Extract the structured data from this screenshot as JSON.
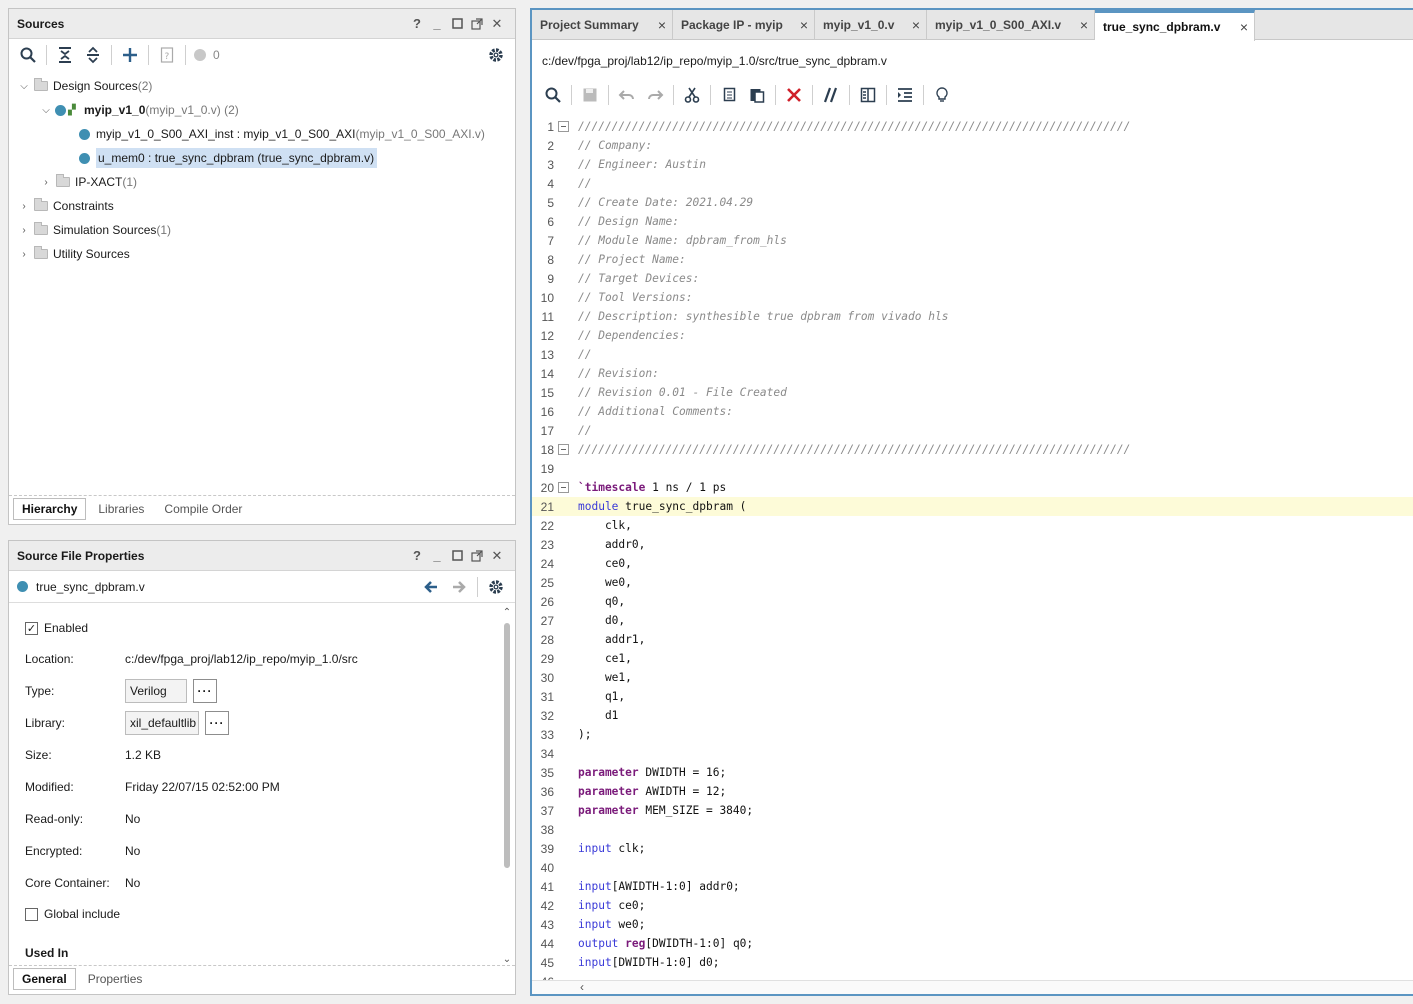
{
  "sources": {
    "title": "Sources",
    "badge_count": "0",
    "tree": [
      {
        "id": "design",
        "label": "Design Sources",
        "suffix": " (2)"
      },
      {
        "id": "myip",
        "label": "myip_v1_0",
        "suffix": " (myip_v1_0.v) (2)"
      },
      {
        "id": "axi",
        "label": "myip_v1_0_S00_AXI_inst : myip_v1_0_S00_AXI",
        "suffix": " (myip_v1_0_S00_AXI.v)"
      },
      {
        "id": "mem",
        "label": "u_mem0 : true_sync_dpbram (true_sync_dpbram.v)",
        "suffix": ""
      },
      {
        "id": "ipxact",
        "label": "IP-XACT",
        "suffix": " (1)"
      },
      {
        "id": "constraints",
        "label": "Constraints",
        "suffix": ""
      },
      {
        "id": "sim",
        "label": "Simulation Sources",
        "suffix": " (1)"
      },
      {
        "id": "util",
        "label": "Utility Sources",
        "suffix": ""
      }
    ],
    "tabs": [
      "Hierarchy",
      "Libraries",
      "Compile Order"
    ]
  },
  "props": {
    "title": "Source File Properties",
    "file": "true_sync_dpbram.v",
    "enabled_label": "Enabled",
    "location_label": "Location:",
    "location": "c:/dev/fpga_proj/lab12/ip_repo/myip_1.0/src",
    "type_label": "Type:",
    "type": "Verilog",
    "library_label": "Library:",
    "library": "xil_defaultlib",
    "size_label": "Size:",
    "size": "1.2 KB",
    "modified_label": "Modified:",
    "modified": "Friday 22/07/15 02:52:00 PM",
    "readonly_label": "Read-only:",
    "readonly": "No",
    "encrypted_label": "Encrypted:",
    "encrypted": "No",
    "core_label": "Core Container:",
    "core": "No",
    "global_label": "Global include",
    "usedin_label": "Used In",
    "tabs": [
      "General",
      "Properties"
    ],
    "dots": "···"
  },
  "editor": {
    "tabs": [
      "Project Summary",
      "Package IP - myip",
      "myip_v1_0.v",
      "myip_v1_0_S00_AXI.v",
      "true_sync_dpbram.v"
    ],
    "path": "c:/dev/fpga_proj/lab12/ip_repo/myip_1.0/src/true_sync_dpbram.v",
    "lines": [
      [
        [
          "cm",
          "//////////////////////////////////////////////////////////////////////////////////"
        ]
      ],
      [
        [
          "cm",
          "// Company:"
        ]
      ],
      [
        [
          "cm",
          "// Engineer: Austin"
        ]
      ],
      [
        [
          "cm",
          "//"
        ]
      ],
      [
        [
          "cm",
          "// Create Date: 2021.04.29"
        ]
      ],
      [
        [
          "cm",
          "// Design Name:"
        ]
      ],
      [
        [
          "cm",
          "// Module Name: dpbram_from_hls"
        ]
      ],
      [
        [
          "cm",
          "// Project Name:"
        ]
      ],
      [
        [
          "cm",
          "// Target Devices:"
        ]
      ],
      [
        [
          "cm",
          "// Tool Versions:"
        ]
      ],
      [
        [
          "cm",
          "// Description: synthesible true dpbram from vivado hls"
        ]
      ],
      [
        [
          "cm",
          "// Dependencies:"
        ]
      ],
      [
        [
          "cm",
          "//"
        ]
      ],
      [
        [
          "cm",
          "// Revision:"
        ]
      ],
      [
        [
          "cm",
          "// Revision 0.01 - File Created"
        ]
      ],
      [
        [
          "cm",
          "// Additional Comments:"
        ]
      ],
      [
        [
          "cm",
          "//"
        ]
      ],
      [
        [
          "cm",
          "//////////////////////////////////////////////////////////////////////////////////"
        ]
      ],
      [
        [
          "pl",
          ""
        ]
      ],
      [
        [
          "kw",
          "`timescale"
        ],
        [
          "pl",
          " 1 ns / 1 ps"
        ]
      ],
      [
        [
          "kw2",
          "module"
        ],
        [
          "pl",
          " true_sync_dpbram ("
        ]
      ],
      [
        [
          "pl",
          "    clk,"
        ]
      ],
      [
        [
          "pl",
          "    addr0,"
        ]
      ],
      [
        [
          "pl",
          "    ce0,"
        ]
      ],
      [
        [
          "pl",
          "    we0,"
        ]
      ],
      [
        [
          "pl",
          "    q0,"
        ]
      ],
      [
        [
          "pl",
          "    d0,"
        ]
      ],
      [
        [
          "pl",
          "    addr1,"
        ]
      ],
      [
        [
          "pl",
          "    ce1,"
        ]
      ],
      [
        [
          "pl",
          "    we1,"
        ]
      ],
      [
        [
          "pl",
          "    q1,"
        ]
      ],
      [
        [
          "pl",
          "    d1"
        ]
      ],
      [
        [
          "pl",
          ");"
        ]
      ],
      [
        [
          "pl",
          ""
        ]
      ],
      [
        [
          "kw",
          "parameter"
        ],
        [
          "pl",
          " DWIDTH = 16;"
        ]
      ],
      [
        [
          "kw",
          "parameter"
        ],
        [
          "pl",
          " AWIDTH = 12;"
        ]
      ],
      [
        [
          "kw",
          "parameter"
        ],
        [
          "pl",
          " MEM_SIZE = 3840;"
        ]
      ],
      [
        [
          "pl",
          ""
        ]
      ],
      [
        [
          "kw2",
          "input"
        ],
        [
          "pl",
          " clk;"
        ]
      ],
      [
        [
          "pl",
          ""
        ]
      ],
      [
        [
          "kw2",
          "input"
        ],
        [
          "pl",
          "[AWIDTH-1:0] addr0;"
        ]
      ],
      [
        [
          "kw2",
          "input"
        ],
        [
          "pl",
          " ce0;"
        ]
      ],
      [
        [
          "kw2",
          "input"
        ],
        [
          "pl",
          " we0;"
        ]
      ],
      [
        [
          "kw2",
          "output"
        ],
        [
          "pl",
          " "
        ],
        [
          "kw",
          "reg"
        ],
        [
          "pl",
          "[DWIDTH-1:0] q0;"
        ]
      ],
      [
        [
          "kw2",
          "input"
        ],
        [
          "pl",
          "[DWIDTH-1:0] d0;"
        ]
      ],
      [
        [
          "pl",
          ""
        ]
      ]
    ]
  }
}
